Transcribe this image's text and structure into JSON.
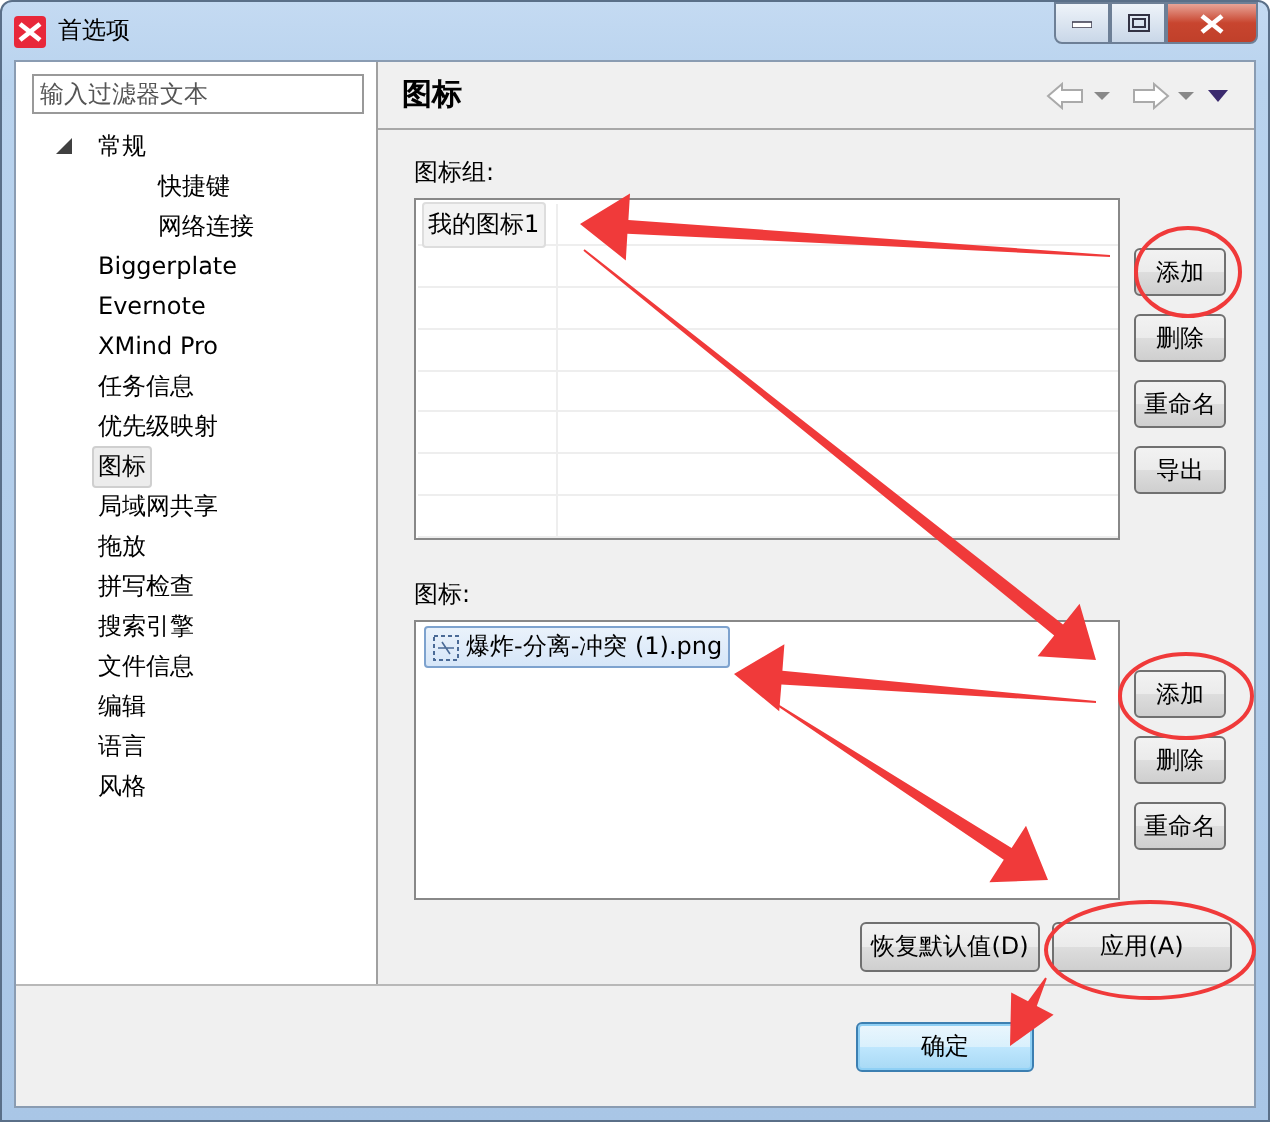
{
  "window": {
    "title": "首选项"
  },
  "filter": {
    "placeholder": "输入过滤器文本"
  },
  "tree": [
    {
      "label": "常规",
      "expanded": true,
      "selected": false,
      "children": [
        {
          "label": "快捷键",
          "selected": false
        },
        {
          "label": "网络连接",
          "selected": false
        }
      ]
    },
    {
      "label": "Biggerplate",
      "selected": false
    },
    {
      "label": "Evernote",
      "selected": false
    },
    {
      "label": "XMind Pro",
      "selected": false
    },
    {
      "label": "任务信息",
      "selected": false
    },
    {
      "label": "优先级映射",
      "selected": false
    },
    {
      "label": "图标",
      "selected": true
    },
    {
      "label": "局域网共享",
      "selected": false
    },
    {
      "label": "拖放",
      "selected": false
    },
    {
      "label": "拼写检查",
      "selected": false
    },
    {
      "label": "搜索引擎",
      "selected": false
    },
    {
      "label": "文件信息",
      "selected": false
    },
    {
      "label": "编辑",
      "selected": false
    },
    {
      "label": "语言",
      "selected": false
    },
    {
      "label": "风格",
      "selected": false
    }
  ],
  "page": {
    "title": "图标"
  },
  "icon_groups": {
    "label": "图标组:",
    "rows": [
      {
        "name": "我的图标1",
        "selected": true
      }
    ],
    "buttons": [
      "添加",
      "删除",
      "重命名",
      "导出"
    ]
  },
  "icons": {
    "label": "图标:",
    "items": [
      {
        "name": "爆炸-分离-冲突 (1).png",
        "selected": true
      }
    ],
    "buttons": [
      "添加",
      "删除",
      "重命名"
    ]
  },
  "footer_buttons": [
    "恢复默认值(D)",
    "应用(A)"
  ],
  "dialog_buttons": [
    "确定"
  ]
}
